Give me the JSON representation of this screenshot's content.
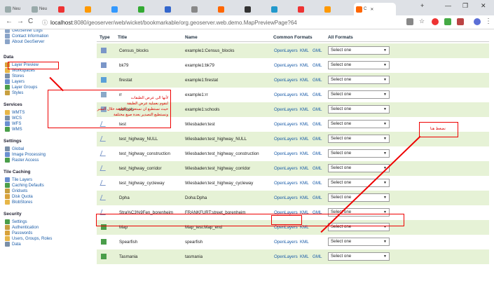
{
  "browser": {
    "tabs": [
      {
        "label": "Neu",
        "color": "#9aa"
      },
      {
        "label": "Neu",
        "color": "#9aa"
      },
      {
        "label": "",
        "color": "#e33"
      },
      {
        "label": "",
        "color": "#f90"
      },
      {
        "label": "",
        "color": "#39f"
      },
      {
        "label": "",
        "color": "#3a3"
      },
      {
        "label": "",
        "color": "#36c"
      },
      {
        "label": "",
        "color": "#888"
      },
      {
        "label": "",
        "color": "#f60"
      },
      {
        "label": "",
        "color": "#333"
      },
      {
        "label": "",
        "color": "#29c"
      },
      {
        "label": "",
        "color": "#e33"
      },
      {
        "label": "",
        "color": "#f90"
      }
    ],
    "active_tab_label": "C",
    "new_tab": "+",
    "minimize": "—",
    "maximize": "❐",
    "close": "✕",
    "url_host": "localhost",
    "url_path": ":8080/geoserver/web/wicket/bookmarkable/org.geoserver.web.demo.MapPreviewPage?64"
  },
  "sidebar": {
    "top_items": [
      "GeoServer Logs",
      "Contact Information",
      "About GeoServer"
    ],
    "sections": [
      {
        "title": "Data",
        "items": [
          "Layer Preview",
          "Workspaces",
          "Stores",
          "Layers",
          "Layer Groups",
          "Styles"
        ]
      },
      {
        "title": "Services",
        "items": [
          "WMTS",
          "WCS",
          "WFS",
          "WMS"
        ]
      },
      {
        "title": "Settings",
        "items": [
          "Global",
          "Image Processing",
          "Raster Access"
        ]
      },
      {
        "title": "Tile Caching",
        "items": [
          "Tile Layers",
          "Caching Defaults",
          "Gridsets",
          "Disk Quota",
          "BlobStores"
        ]
      },
      {
        "title": "Security",
        "items": [
          "Settings",
          "Authentication",
          "Passwords",
          "Users, Groups, Roles",
          "Data"
        ]
      }
    ]
  },
  "table": {
    "headers": {
      "type": "Type",
      "title": "Title",
      "name": "Name",
      "formats": "Common Formats",
      "all": "All Formats"
    },
    "select_placeholder": "Select one",
    "rows": [
      {
        "title": "Census_blocks",
        "name": "example1:Census_blocks",
        "formats": [
          "OpenLayers",
          "KML",
          "GML"
        ]
      },
      {
        "title": "bk79",
        "name": "example1:bk79",
        "formats": [
          "OpenLayers",
          "KML",
          "GML"
        ]
      },
      {
        "title": "firestat",
        "name": "example1:firestat",
        "formats": [
          "OpenLayers",
          "KML",
          "GML"
        ]
      },
      {
        "title": "rr",
        "name": "example1:rr",
        "formats": [
          "OpenLayers",
          "KML",
          "GML"
        ]
      },
      {
        "title": "schools",
        "name": "example1:schools",
        "formats": [
          "OpenLayers",
          "KML",
          "GML"
        ]
      },
      {
        "title": "test",
        "name": "Wiesbaden:test",
        "formats": [
          "OpenLayers",
          "KML",
          "GML"
        ]
      },
      {
        "title": "test_highway_NULL",
        "name": "Wiesbaden:test_highway_NULL",
        "formats": [
          "OpenLayers",
          "KML",
          "GML"
        ]
      },
      {
        "title": "test_highway_construction",
        "name": "Wiesbaden:test_highway_construction",
        "formats": [
          "OpenLayers",
          "KML",
          "GML"
        ]
      },
      {
        "title": "test_highway_corridor",
        "name": "Wiesbaden:test_highway_corridor",
        "formats": [
          "OpenLayers",
          "KML",
          "GML"
        ]
      },
      {
        "title": "test_highway_cycleway",
        "name": "Wiesbaden:test_highway_cycleway",
        "formats": [
          "OpenLayers",
          "KML",
          "GML"
        ]
      },
      {
        "title": "Dpha",
        "name": "Doha:Dpha",
        "formats": [
          "OpenLayers",
          "KML",
          "GML"
        ]
      },
      {
        "title": "Stra%C3%9Fen_borenheim",
        "name": "FRANKFURT:street_borenheim",
        "formats": [
          "OpenLayers",
          "KML",
          "GML"
        ]
      },
      {
        "title": "Map",
        "name": "Map_test:Map_end",
        "formats": [
          "OpenLayers",
          "KML"
        ]
      },
      {
        "title": "Spearfish",
        "name": "spearfish",
        "formats": [
          "OpenLayers",
          "KML"
        ]
      },
      {
        "title": "Tasmania",
        "name": "tasmania",
        "formats": [
          "OpenLayers",
          "KML",
          "GML"
        ]
      }
    ]
  },
  "annotations": {
    "note_left_1": "لأنها الى عرض الطبقات",
    "note_left_2": "لنقوم بعملية عرض الطبقة",
    "note_left_3": "حيث نستطيع ان نستعرض الطبقة خلال النشر",
    "note_left_4": "ونستطيع التصدير بعدة صيغ مختلفة",
    "note_right": "نضغط هنا"
  },
  "colors": {
    "accent": "#1a5ca8",
    "alt_row": "#e6f2d6",
    "annotation": "#ee0000"
  }
}
